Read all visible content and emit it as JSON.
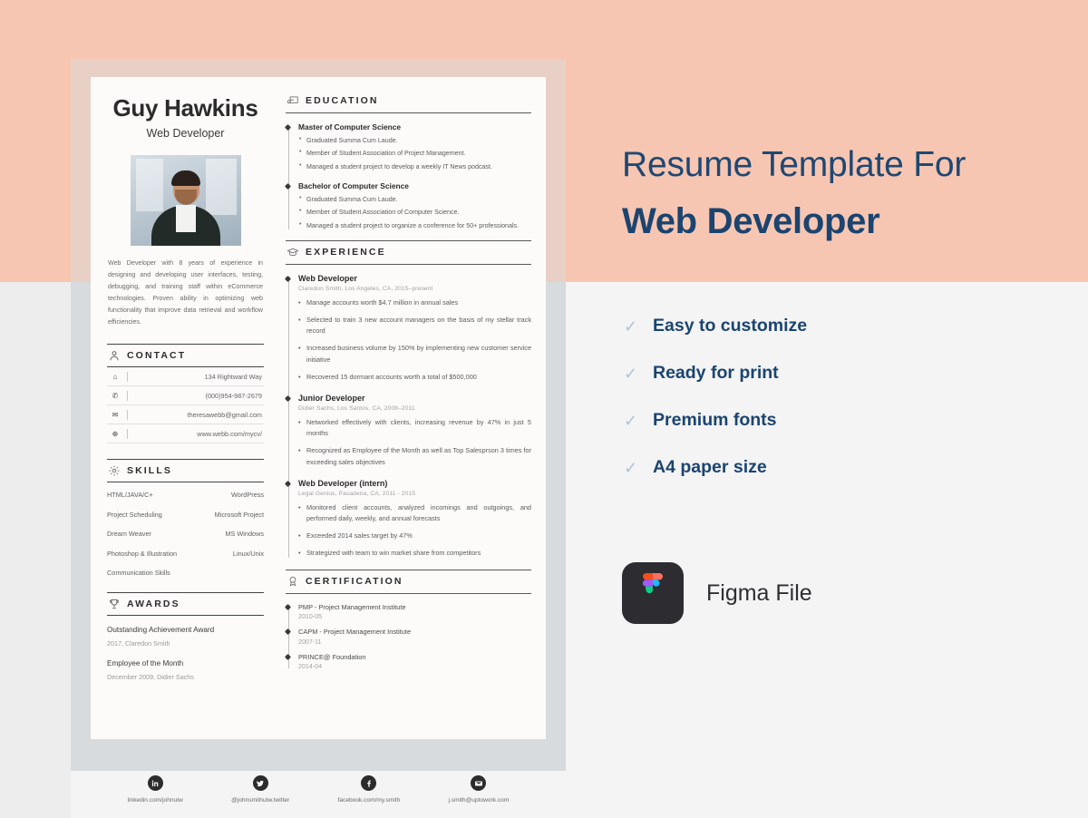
{
  "colors": {
    "peach": "#F7C6B2",
    "navy": "#1B4470",
    "page": "#FCFBFA",
    "frame": "#D7DBDD",
    "check": "#AFC4D4"
  },
  "resume": {
    "name": "Guy Hawkins",
    "role": "Web Developer",
    "photo_alt": "portrait-photo",
    "bio": "Web Developer with 8 years of experience in designing and developing user interfaces, testing, debugging, and training staff within eCommerce technologies. Proven ability in optimizing web functionality that improve data retrieval and workflow efficiencies.",
    "contact": {
      "title": "CONTACT",
      "icon": "person-icon",
      "rows": [
        {
          "icon": "home-icon",
          "value": "134 Rightward Way"
        },
        {
          "icon": "phone-icon",
          "value": "(000)954-987-2679"
        },
        {
          "icon": "envelope-icon",
          "value": "theresawebb@gmail.com"
        },
        {
          "icon": "globe-icon",
          "value": "www.webb.com/mycv/"
        }
      ]
    },
    "skills": {
      "title": "SKILLS",
      "icon": "gear-icon",
      "rows": [
        {
          "left": "HTML/JAVA/C+",
          "right": "WordPress"
        },
        {
          "left": "Project Scheduling",
          "right": "Microsoft Project"
        },
        {
          "left": "Dream Weaver",
          "right": "MS Windows"
        },
        {
          "left": "Photoshop & Illustration",
          "right": "Linux/Unix"
        },
        {
          "left": "Communication Skills",
          "right": ""
        }
      ]
    },
    "awards": {
      "title": "AWARDS",
      "icon": "trophy-icon",
      "items": [
        {
          "title": "Outstanding Achievement Award",
          "sub": "2017, Claredon Smith"
        },
        {
          "title": "Employee of the Month",
          "sub": "December 2009, Didier Sachs"
        }
      ]
    },
    "education": {
      "title": "EDUCATION",
      "icon": "diploma-icon",
      "items": [
        {
          "degree": "Master of Computer Science",
          "bullets": [
            "Graduated Summa Cum Laude.",
            "Member of Student Association of Project Management.",
            "Managed a student project to develop a weekly IT News podcast."
          ]
        },
        {
          "degree": "Bachelor of Computer Science",
          "bullets": [
            "Graduated Summa Cum Laude.",
            "Member of Student Association of Computer Science.",
            "Managed a student project to organize a conference for 50+ professionals."
          ]
        }
      ]
    },
    "experience": {
      "title": "EXPERIENCE",
      "icon": "graduation-cap-icon",
      "items": [
        {
          "title": "Web Developer",
          "meta": "Claredon Smith, Los Angeles, CA, 2015–present",
          "bullets": [
            "Manage accounts worth $4.7 million in annual sales",
            "Selected to train 3 new account managers on the basis of my stellar track record",
            "Increased business volume by 150% by implementing new customer service initiative",
            "Recovered 15 dormant accounts worth a total of $500,000"
          ]
        },
        {
          "title": "Junior Developer",
          "meta": "Didier Sachs, Los Santos, CA, 2008–2011",
          "bullets": [
            "Networked effectively with clients, increasing revenue by 47% in just 5 months",
            "Recognized as Employee of the Month as well as Top Salesprson 3 times for exceeding sales objectives"
          ]
        },
        {
          "title": "Web Developer (intern)",
          "meta": "Legal Genius, Pasadena, CA, 2011 - 2015",
          "bullets": [
            "Monitored client accounts, analyzed incomings and outgoings, and performed daily, weekly, and annual forecasts",
            "Exceeded 2014 sales target by 47%",
            "Strategized with team to win market share from competitors"
          ]
        }
      ]
    },
    "certification": {
      "title": "CERTIFICATION",
      "icon": "award-ribbon-icon",
      "items": [
        {
          "title": "PMP - Project Management Institute",
          "date": "2010-05"
        },
        {
          "title": "CAPM - Project Management Institute",
          "date": "2007-11"
        },
        {
          "title": "PRINCE@ Foundation",
          "date": "2014-04"
        }
      ]
    },
    "social": [
      {
        "icon": "linkedin-icon",
        "label": "linkedin.com/johnutw"
      },
      {
        "icon": "twitter-icon",
        "label": "@johnsmithutw.twitter"
      },
      {
        "icon": "facebook-icon",
        "label": "facebook.com/my.smith"
      },
      {
        "icon": "email-icon",
        "label": "j.smith@uptowork.com"
      }
    ]
  },
  "promo": {
    "heading_line1": "Resume Template For",
    "heading_line2": "Web Developer",
    "features": [
      {
        "check": "✓",
        "label": "Easy to customize"
      },
      {
        "check": "✓",
        "label": "Ready for print"
      },
      {
        "check": "✓",
        "label": "Premium fonts"
      },
      {
        "check": "✓",
        "label": "A4 paper size"
      }
    ],
    "figma_label": "Figma File",
    "figma_icon": "figma-logo-icon"
  }
}
